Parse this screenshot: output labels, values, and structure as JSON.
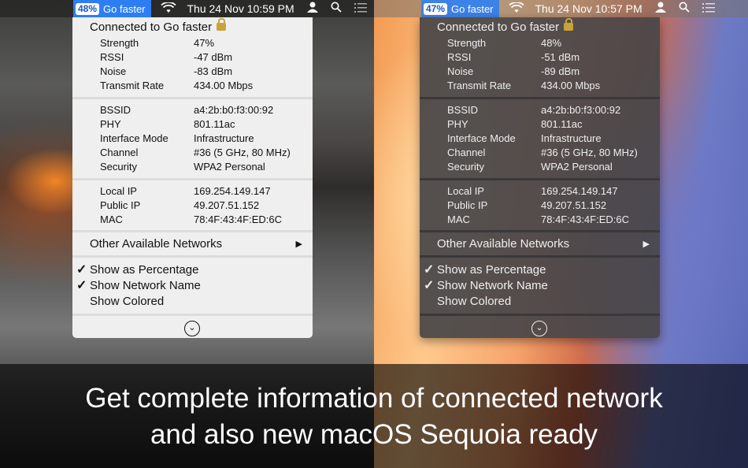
{
  "left": {
    "menubar": {
      "percent": "48%",
      "network_name": "Go faster",
      "clock": "Thu 24 Nov  10:59 PM"
    },
    "menu": {
      "header": "Connected to Go faster",
      "stats": [
        {
          "k": "Strength",
          "v": "47%"
        },
        {
          "k": "RSSI",
          "v": "-47 dBm"
        },
        {
          "k": "Noise",
          "v": "-83 dBm"
        },
        {
          "k": "Transmit Rate",
          "v": "434.00 Mbps"
        }
      ],
      "details": [
        {
          "k": "BSSID",
          "v": "a4:2b:b0:f3:00:92"
        },
        {
          "k": "PHY",
          "v": "801.11ac"
        },
        {
          "k": "Interface Mode",
          "v": "Infrastructure"
        },
        {
          "k": "Channel",
          "v": "#36 (5 GHz, 80 MHz)"
        },
        {
          "k": "Security",
          "v": "WPA2 Personal"
        }
      ],
      "addresses": [
        {
          "k": "Local IP",
          "v": "169.254.149.147"
        },
        {
          "k": "Public IP",
          "v": "49.207.51.152"
        },
        {
          "k": "MAC",
          "v": "78:4F:43:4F:ED:6C"
        }
      ],
      "other_networks": "Other Available Networks",
      "options": [
        {
          "label": "Show as Percentage",
          "checked": "✓"
        },
        {
          "label": "Show Network Name",
          "checked": "✓"
        },
        {
          "label": "Show Colored",
          "checked": ""
        }
      ]
    }
  },
  "right": {
    "menubar": {
      "percent": "47%",
      "network_name": "Go faster",
      "clock": "Thu 24 Nov  10:57 PM"
    },
    "menu": {
      "header": "Connected to Go faster",
      "stats": [
        {
          "k": "Strength",
          "v": "48%"
        },
        {
          "k": "RSSI",
          "v": "-51 dBm"
        },
        {
          "k": "Noise",
          "v": "-89 dBm"
        },
        {
          "k": "Transmit Rate",
          "v": "434.00 Mbps"
        }
      ],
      "details": [
        {
          "k": "BSSID",
          "v": "a4:2b:b0:f3:00:92"
        },
        {
          "k": "PHY",
          "v": "801.11ac"
        },
        {
          "k": "Interface Mode",
          "v": "Infrastructure"
        },
        {
          "k": "Channel",
          "v": "#36 (5 GHz, 80 MHz)"
        },
        {
          "k": "Security",
          "v": "WPA2 Personal"
        }
      ],
      "addresses": [
        {
          "k": "Local IP",
          "v": "169.254.149.147"
        },
        {
          "k": "Public IP",
          "v": "49.207.51.152"
        },
        {
          "k": "MAC",
          "v": "78:4F:43:4F:ED:6C"
        }
      ],
      "other_networks": "Other Available Networks",
      "options": [
        {
          "label": "Show as Percentage",
          "checked": "✓"
        },
        {
          "label": "Show Network Name",
          "checked": "✓"
        },
        {
          "label": "Show Colored",
          "checked": ""
        }
      ]
    }
  },
  "icons": {
    "wifi": "wifi-icon",
    "user": "user-icon",
    "search": "search-icon",
    "list": "list-icon",
    "lock": "lock-icon",
    "arrow": "submenu-arrow-icon",
    "chevron": "chevron-down-circle-icon"
  },
  "caption": {
    "line1": "Get complete information of connected network",
    "line2": "and also new macOS Sequoia ready"
  }
}
